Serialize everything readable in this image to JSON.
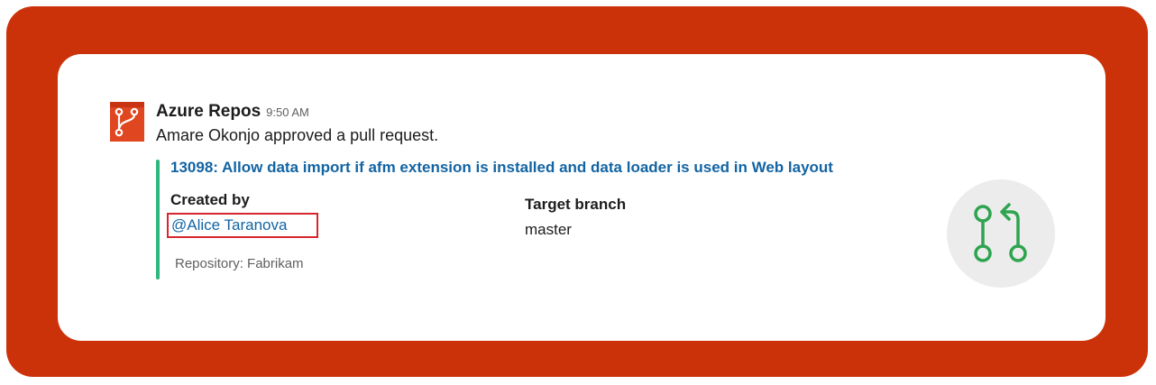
{
  "app": {
    "name": "Azure Repos",
    "time": "9:50 AM",
    "icon": "azure-repos-icon",
    "accent_color": "#e0461f"
  },
  "message": {
    "text": "Amare Okonjo approved a pull request."
  },
  "attachment": {
    "bar_color": "#2eb67d",
    "title": "13098: Allow data import if afm extension is installed and data loader is used in Web layout",
    "fields": [
      {
        "label": "Created by",
        "value": "@Alice Taranova"
      },
      {
        "label": "Target branch",
        "value": "master"
      }
    ],
    "footer": "Repository: Fabrikam",
    "thumb_icon": "pull-request-icon",
    "thumb_icon_color": "#2ea44f"
  },
  "frame": {
    "border_color": "#cc3209",
    "highlight_color": "#d7262e"
  }
}
